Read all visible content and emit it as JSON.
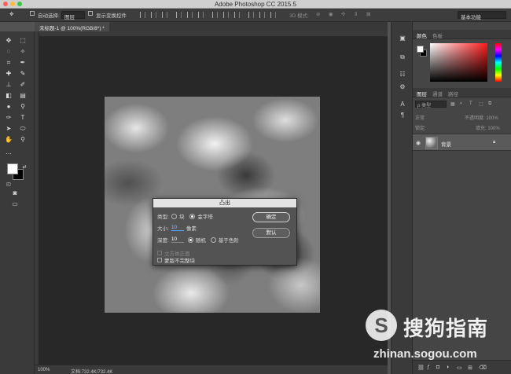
{
  "window": {
    "title": "Adobe Photoshop CC 2015.5"
  },
  "options_bar": {
    "auto_select_label": "自动选择:",
    "auto_select_value": "图层",
    "show_transform_label": "显示变换控件",
    "mode_3d": "3D 模式:",
    "workspace": "基本功能"
  },
  "document_tab": {
    "label": "未标题-1 @ 100%(RGB/8*) *"
  },
  "dialog": {
    "title": "凸出",
    "type_label": "类型:",
    "type_opt_block": "块",
    "type_opt_pyramid": "金字塔",
    "size_label": "大小:",
    "size_value": "10",
    "size_unit": "像素",
    "depth_label": "深度:",
    "depth_value": "10",
    "depth_opt_random": "随机",
    "depth_opt_level": "基于色阶",
    "solid_front": "立方体正面",
    "mask_incomplete": "蒙版不完整块",
    "ok_label": "确定",
    "cancel_label": "默认"
  },
  "status_bar": {
    "zoom": "100%",
    "doc_info": "文档:732.4K/732.4K"
  },
  "color_panel": {
    "tab_color": "颜色",
    "tab_swatches": "色板"
  },
  "layers_panel": {
    "tab_layers": "图层",
    "tab_channels": "通道",
    "tab_paths": "路径",
    "filter_label": "ρ 类型",
    "blend_mode": "正常",
    "opacity_label": "不透明度: 100%",
    "lock_label": "锁定:",
    "fill_label": "填充: 100%",
    "layer_name": "背景"
  },
  "watermark": {
    "brand": "搜狗指南",
    "url": "zhinan.sogou.com"
  },
  "colors": {
    "accent_blue": "#5aa0ff",
    "canvas_bg": "#282828",
    "panel_bg": "#454545"
  }
}
